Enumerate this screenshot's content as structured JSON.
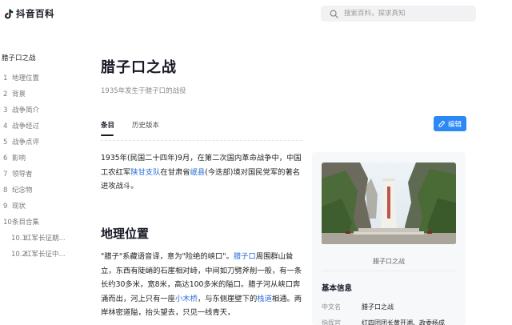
{
  "header": {
    "logo_text": "抖音百科",
    "search_placeholder": "搜索百科，探求真知"
  },
  "toc": {
    "title": "腊子口之战",
    "items": [
      {
        "num": "1",
        "label": "地理位置"
      },
      {
        "num": "2",
        "label": "背景"
      },
      {
        "num": "3",
        "label": "战争简介"
      },
      {
        "num": "4",
        "label": "战争经过"
      },
      {
        "num": "5",
        "label": "战争点评"
      },
      {
        "num": "6",
        "label": "影响"
      },
      {
        "num": "7",
        "label": "领导者"
      },
      {
        "num": "8",
        "label": "纪念物"
      },
      {
        "num": "9",
        "label": "现状"
      },
      {
        "num": "10",
        "label": "条目合集"
      }
    ],
    "subitems": [
      {
        "num": "10.1",
        "label": "红军长征期..."
      },
      {
        "num": "10.2",
        "label": "红军长征中..."
      }
    ]
  },
  "article": {
    "title": "腊子口之战",
    "subtitle": "1935年发生于腊子口的战役",
    "tabs": [
      "条目",
      "历史版本"
    ],
    "edit_label": "编辑",
    "intro": {
      "t1": "1935年(民国二十四年)9月，在第二次国内革命战争中，中国工农红军",
      "link1": "陕甘支队",
      "t2": "在甘肃省",
      "link2": "岷县",
      "t3": "(今迭部)境对国民党军的著名进攻战斗。"
    },
    "section_heading": "地理位置",
    "geo": {
      "t1": "\"腊子\"系藏语音译，意为\"险绝的峡口\"。",
      "link1": "腊子口",
      "t2": "周围群山耸立，东西有陡峭的石崖相对峙，中间如刀劈斧削一般，有一条长约30多米，宽8米，高达100多米的隘口。腊子河从峡口奔涌而出，河上只有一座",
      "link2": "小木桥",
      "t3": "，与东侧崖壁下的",
      "link3": "栈道",
      "t4": "相通。两岸林密道隘，抬头望去，只见一线青天，"
    }
  },
  "info_card": {
    "caption": "腊子口之战",
    "title": "基本信息",
    "rows": [
      {
        "key": "中文名",
        "value": "腊子口之战"
      },
      {
        "key": "指挥官",
        "value": "红四团团长黄开湘、政委杨成"
      }
    ]
  },
  "colors": {
    "link": "#2b6fd6",
    "edit_button": "#2b88f5",
    "card_bg": "#f7f8fa"
  }
}
